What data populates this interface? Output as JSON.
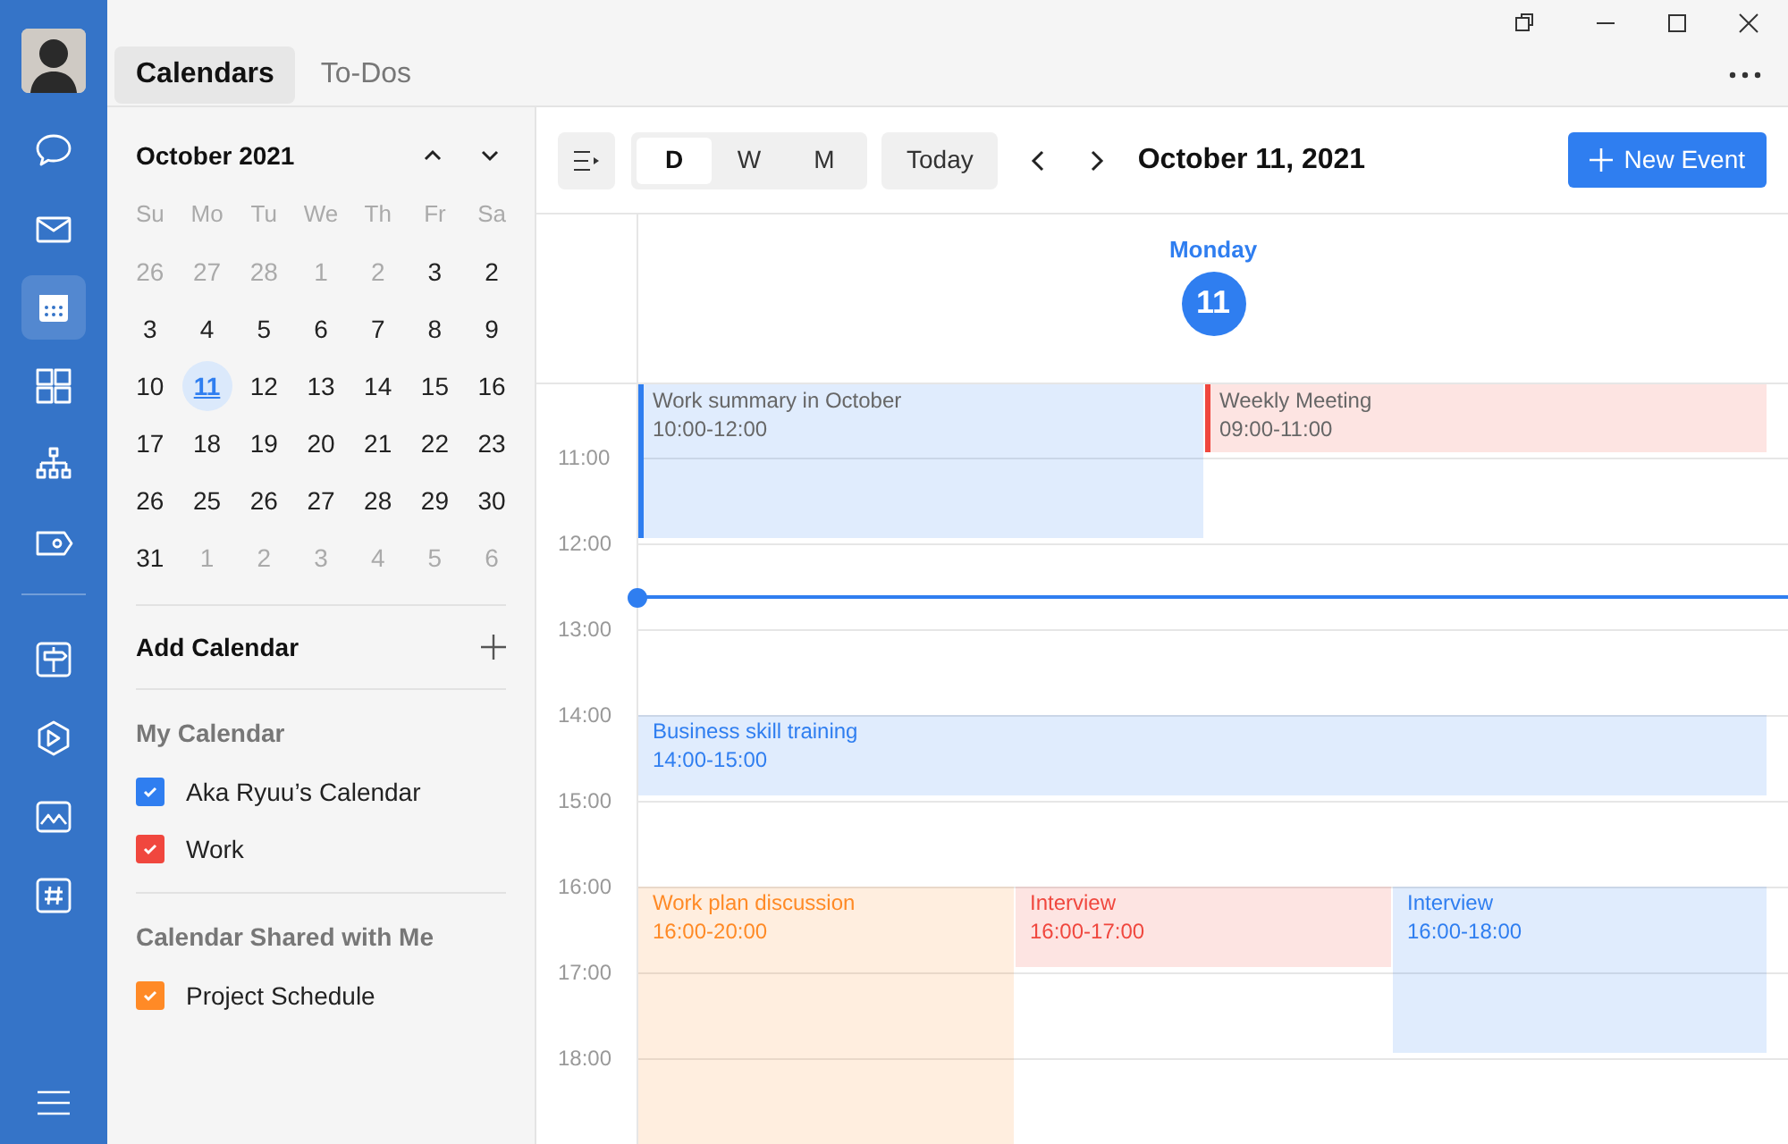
{
  "nav_items": [
    {
      "selected": false
    },
    {
      "selected": false
    },
    {
      "selected": true
    },
    {
      "selected": false
    },
    {
      "selected": false
    },
    {
      "selected": false
    },
    {
      "selected": false
    },
    {
      "selected": false
    },
    {
      "selected": false
    },
    {
      "selected": false
    }
  ],
  "tabs": [
    {
      "label": "Calendars",
      "selected": true
    },
    {
      "label": "To-Dos",
      "selected": false
    }
  ],
  "mini_calendar": {
    "title": "October 2021",
    "weekdays": [
      "Su",
      "Mo",
      "Tu",
      "We",
      "Th",
      "Fr",
      "Sa"
    ],
    "days": [
      {
        "text": "26",
        "muted": true,
        "selected": false
      },
      {
        "text": "27",
        "muted": true,
        "selected": false
      },
      {
        "text": "28",
        "muted": true,
        "selected": false
      },
      {
        "text": "1",
        "muted": true,
        "selected": false
      },
      {
        "text": "2",
        "muted": true,
        "selected": false
      },
      {
        "text": "3",
        "muted": false,
        "selected": false
      },
      {
        "text": "2",
        "muted": false,
        "selected": false
      },
      {
        "text": "3",
        "muted": false,
        "selected": false
      },
      {
        "text": "4",
        "muted": false,
        "selected": false
      },
      {
        "text": "5",
        "muted": false,
        "selected": false
      },
      {
        "text": "6",
        "muted": false,
        "selected": false
      },
      {
        "text": "7",
        "muted": false,
        "selected": false
      },
      {
        "text": "8",
        "muted": false,
        "selected": false
      },
      {
        "text": "9",
        "muted": false,
        "selected": false
      },
      {
        "text": "10",
        "muted": false,
        "selected": false
      },
      {
        "text": "11",
        "muted": false,
        "selected": true
      },
      {
        "text": "12",
        "muted": false,
        "selected": false
      },
      {
        "text": "13",
        "muted": false,
        "selected": false
      },
      {
        "text": "14",
        "muted": false,
        "selected": false
      },
      {
        "text": "15",
        "muted": false,
        "selected": false
      },
      {
        "text": "16",
        "muted": false,
        "selected": false
      },
      {
        "text": "17",
        "muted": false,
        "selected": false
      },
      {
        "text": "18",
        "muted": false,
        "selected": false
      },
      {
        "text": "19",
        "muted": false,
        "selected": false
      },
      {
        "text": "20",
        "muted": false,
        "selected": false
      },
      {
        "text": "21",
        "muted": false,
        "selected": false
      },
      {
        "text": "22",
        "muted": false,
        "selected": false
      },
      {
        "text": "23",
        "muted": false,
        "selected": false
      },
      {
        "text": "26",
        "muted": false,
        "selected": false
      },
      {
        "text": "25",
        "muted": false,
        "selected": false
      },
      {
        "text": "26",
        "muted": false,
        "selected": false
      },
      {
        "text": "27",
        "muted": false,
        "selected": false
      },
      {
        "text": "28",
        "muted": false,
        "selected": false
      },
      {
        "text": "29",
        "muted": false,
        "selected": false
      },
      {
        "text": "30",
        "muted": false,
        "selected": false
      },
      {
        "text": "31",
        "muted": false,
        "selected": false
      },
      {
        "text": "1",
        "muted": true,
        "selected": false
      },
      {
        "text": "2",
        "muted": true,
        "selected": false
      },
      {
        "text": "3",
        "muted": true,
        "selected": false
      },
      {
        "text": "4",
        "muted": true,
        "selected": false
      },
      {
        "text": "5",
        "muted": true,
        "selected": false
      },
      {
        "text": "6",
        "muted": true,
        "selected": false
      }
    ]
  },
  "add_calendar": "Add Calendar",
  "calendar_groups": [
    {
      "title": "My Calendar",
      "items": [
        {
          "label": "Aka Ryuu’s Calendar",
          "checked": true,
          "color": "#2f7ef0"
        },
        {
          "label": "Work",
          "checked": true,
          "color": "#f0473e"
        }
      ]
    },
    {
      "title": "Calendar Shared with Me",
      "items": [
        {
          "label": "Project Schedule",
          "checked": true,
          "color": "#ff8a26"
        }
      ]
    }
  ],
  "toolbar": {
    "views": [
      {
        "label": "D",
        "selected": true
      },
      {
        "label": "W",
        "selected": false
      },
      {
        "label": "M",
        "selected": false
      }
    ],
    "today": "Today",
    "date": "October 11, 2021",
    "new_event": "New Event"
  },
  "day_header": {
    "weekday": "Monday",
    "date": "11"
  },
  "hours": [
    "11:00",
    "12:00",
    "13:00",
    "14:00",
    "15:00",
    "16:00",
    "17:00",
    "18:00"
  ],
  "events": [
    {
      "title": "Work summary in October",
      "time": "10:00-12:00",
      "color": "#2f7ef0",
      "past": true
    },
    {
      "title": "Weekly Meeting",
      "time": "09:00-11:00",
      "color": "#f0473e",
      "past": true
    },
    {
      "title": "Business skill training",
      "time": "14:00-15:00",
      "color": "#2f7ef0",
      "past": false
    },
    {
      "title": "Work plan discussion",
      "time": "16:00-20:00",
      "color": "#ff8a26",
      "past": false
    },
    {
      "title": "Interview",
      "time": "16:00-17:00",
      "color": "#f0473e",
      "past": false
    },
    {
      "title": "Interview",
      "time": "16:00-18:00",
      "color": "#2f7ef0",
      "past": false
    }
  ]
}
